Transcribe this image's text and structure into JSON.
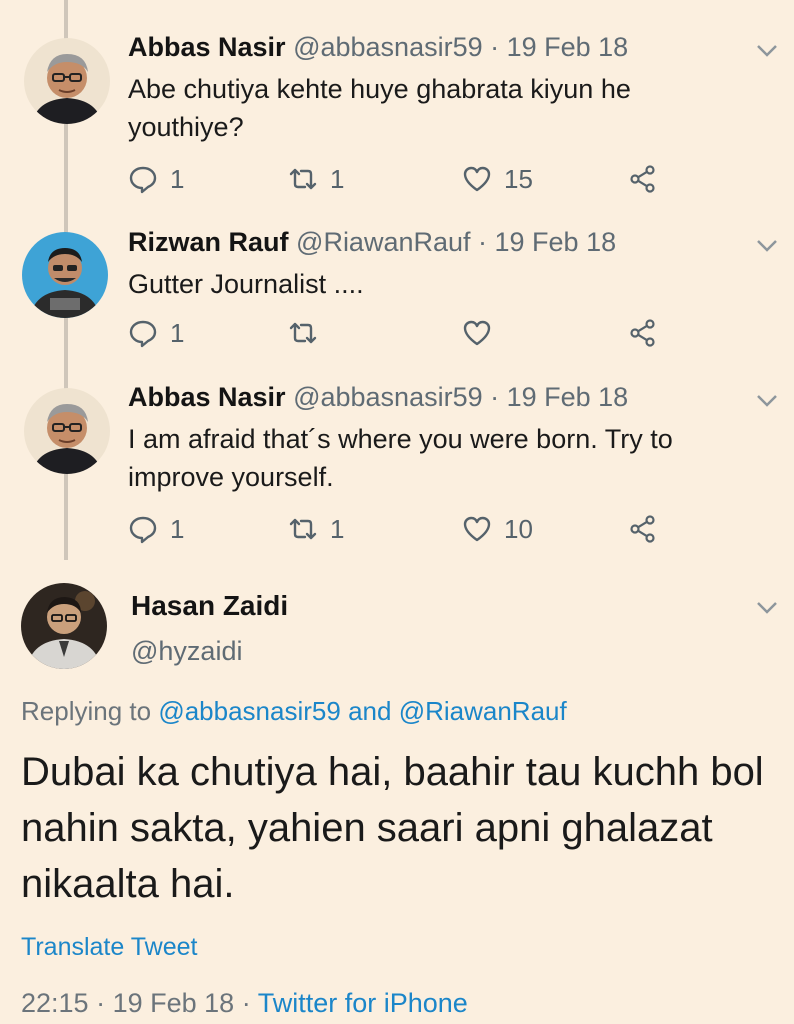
{
  "replies": [
    {
      "name": "Abbas Nasir",
      "meta": "@abbasnasir59 · 19 Feb 18",
      "text": "Abe chutiya kehte huye ghabrata kiyun he youthiye?",
      "reply_count": "1",
      "retweet_count": "1",
      "like_count": "15"
    },
    {
      "name": "Rizwan Rauf",
      "meta": "@RiawanRauf · 19 Feb 18",
      "text": "Gutter Journalist ....",
      "reply_count": "1",
      "retweet_count": "",
      "like_count": ""
    },
    {
      "name": "Abbas Nasir",
      "meta": "@abbasnasir59 · 19 Feb 18",
      "text": "I am afraid that´s where you were born. Try to improve yourself.",
      "reply_count": "1",
      "retweet_count": "1",
      "like_count": "10"
    }
  ],
  "main_tweet": {
    "name": "Hasan Zaidi",
    "handle": "@hyzaidi",
    "replying_prefix": "Replying to",
    "replying_user1": "@abbasnasir59",
    "replying_and": "and",
    "replying_user2": "@RiawanRauf",
    "text": "Dubai ka chutiya hai, baahir tau kuchh bol nahin sakta, yahien saari apni ghalazat nikaalta hai.",
    "translate_label": "Translate Tweet",
    "time": "22:15",
    "date": "19 Feb 18",
    "source": "Twitter for iPhone",
    "separator": "·"
  },
  "icons": {
    "reply": "reply-icon",
    "retweet": "retweet-icon",
    "like": "heart-icon",
    "share": "share-icon",
    "menu": "chevron-down-icon"
  },
  "colors": {
    "background": "#fbefdf",
    "link": "#1b86c9",
    "secondary_text": "#5f6b74",
    "thread_line": "#cfc6ba"
  }
}
